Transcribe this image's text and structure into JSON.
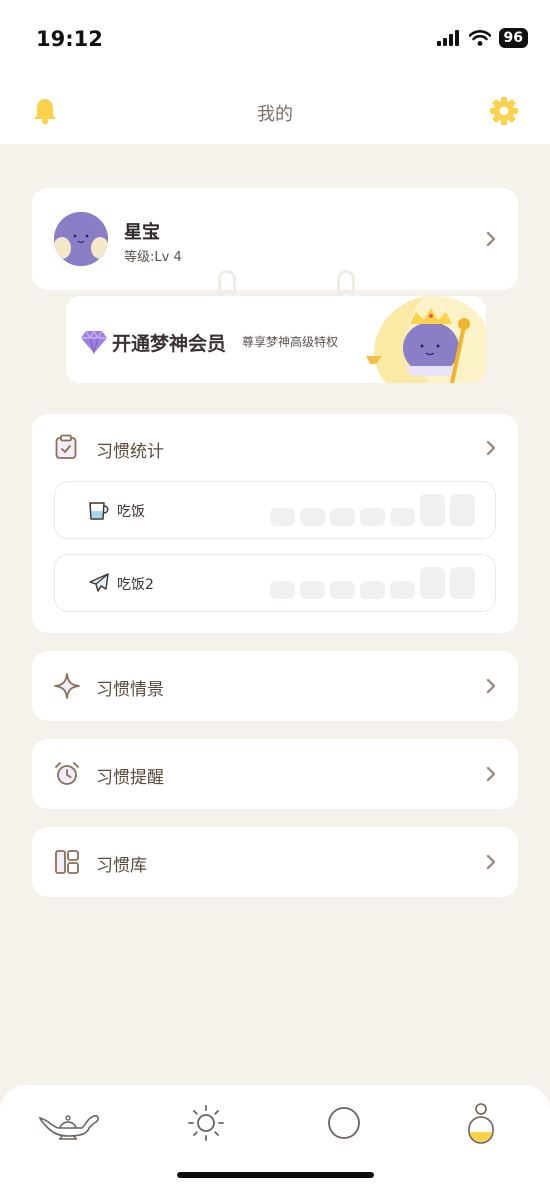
{
  "status_bar": {
    "time": "19:12",
    "battery": "96"
  },
  "header": {
    "title": "我的"
  },
  "profile": {
    "name": "星宝",
    "level": "等级:Lv 4"
  },
  "vip": {
    "title": "开通梦神会员",
    "subtitle": "尊享梦神高级特权"
  },
  "habit_stats": {
    "title": "习惯统计",
    "habits": [
      {
        "name": "吃饭",
        "icon": "cup-icon"
      },
      {
        "name": "吃饭2",
        "icon": "plane-icon"
      }
    ]
  },
  "menu": [
    {
      "label": "习惯情景",
      "icon": "sparkle-icon"
    },
    {
      "label": "习惯提醒",
      "icon": "alarm-clock-icon"
    },
    {
      "label": "习惯库",
      "icon": "library-icon"
    }
  ],
  "tabs": [
    {
      "icon": "magic-lamp-icon"
    },
    {
      "icon": "sun-icon"
    },
    {
      "icon": "circle-icon"
    },
    {
      "icon": "person-icon",
      "active": true
    }
  ],
  "colors": {
    "accent": "#fcd24a",
    "background": "#f5f2ec",
    "avatar": "#8a7fc7"
  }
}
